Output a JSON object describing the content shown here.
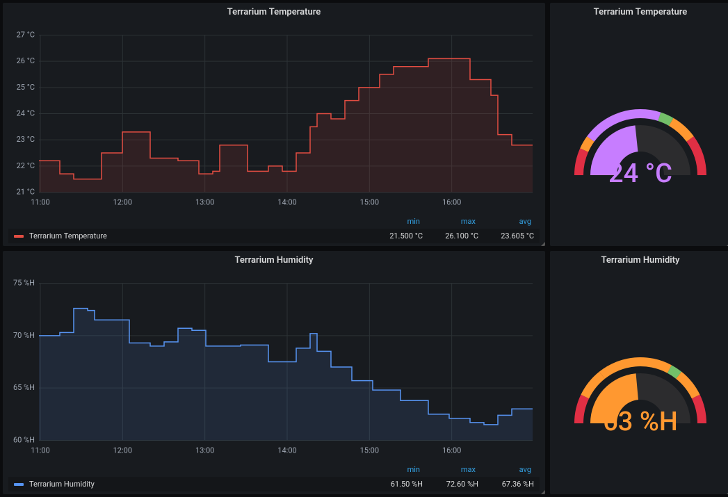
{
  "panels": {
    "temp_chart_title": "Terrarium Temperature",
    "temp_gauge_title": "Terrarium Temperature",
    "hum_chart_title": "Terrarium Humidity",
    "hum_gauge_title": "Terrarium Humidity"
  },
  "legend_headers": {
    "min": "min",
    "max": "max",
    "avg": "avg"
  },
  "temp_legend": {
    "name": "Terrarium Temperature",
    "color": "#e24d42",
    "min": "21.500 °C",
    "max": "26.100 °C",
    "avg": "23.605 °C"
  },
  "hum_legend": {
    "name": "Terrarium Humidity",
    "color": "#5794f2",
    "min": "61.50 %H",
    "max": "72.60 %H",
    "avg": "67.36 %H"
  },
  "temp_gauge": {
    "value_text": "24 °C",
    "value": 24,
    "min": 10,
    "max": 40,
    "color": "#c77dff",
    "thresholds": [
      {
        "from": 10,
        "to": 14,
        "color": "#e02f44"
      },
      {
        "from": 14,
        "to": 16,
        "color": "#ff9830"
      },
      {
        "from": 16,
        "to": 28,
        "color": "#c77dff"
      },
      {
        "from": 28,
        "to": 30,
        "color": "#73bf69"
      },
      {
        "from": 30,
        "to": 34,
        "color": "#ff9830"
      },
      {
        "from": 34,
        "to": 40,
        "color": "#e02f44"
      }
    ]
  },
  "hum_gauge": {
    "value_text": "63 %H",
    "value": 63,
    "min": 30,
    "max": 100,
    "color": "#ff9830",
    "thresholds": [
      {
        "from": 30,
        "to": 40,
        "color": "#e02f44"
      },
      {
        "from": 40,
        "to": 50,
        "color": "#ff9830"
      },
      {
        "from": 50,
        "to": 76,
        "color": "#ff9830"
      },
      {
        "from": 76,
        "to": 80,
        "color": "#73bf69"
      },
      {
        "from": 80,
        "to": 90,
        "color": "#ff9830"
      },
      {
        "from": 90,
        "to": 100,
        "color": "#e02f44"
      }
    ]
  },
  "chart_data": [
    {
      "type": "area",
      "title": "Terrarium Temperature",
      "xlabel": "",
      "ylabel": "°C",
      "ylim": [
        21,
        27
      ],
      "x_ticks": [
        "11:00",
        "12:00",
        "13:00",
        "14:00",
        "15:00",
        "16:00"
      ],
      "y_ticks": [
        21,
        22,
        23,
        24,
        25,
        26,
        27
      ],
      "series": [
        {
          "name": "Terrarium Temperature",
          "color": "#e24d42",
          "step": true,
          "y": [
            22.2,
            22.2,
            22.2,
            21.7,
            21.7,
            21.5,
            21.5,
            21.5,
            21.5,
            22.5,
            22.5,
            22.5,
            23.3,
            23.3,
            23.3,
            23.3,
            22.3,
            22.3,
            22.3,
            22.3,
            22.2,
            22.2,
            22.2,
            21.7,
            21.7,
            21.8,
            22.8,
            22.8,
            22.8,
            22.8,
            21.8,
            21.8,
            21.8,
            22.0,
            22.0,
            21.8,
            21.8,
            22.5,
            22.5,
            23.5,
            24.0,
            24.0,
            23.8,
            23.8,
            24.5,
            24.5,
            25.0,
            25.0,
            25.0,
            25.5,
            25.5,
            25.8,
            25.8,
            25.8,
            25.8,
            25.8,
            26.1,
            26.1,
            26.1,
            26.1,
            26.1,
            26.1,
            25.3,
            25.3,
            25.3,
            24.7,
            23.2,
            23.2,
            22.8,
            22.8,
            22.8,
            22.8
          ]
        }
      ]
    },
    {
      "type": "area",
      "title": "Terrarium Humidity",
      "xlabel": "",
      "ylabel": "%H",
      "ylim": [
        60,
        75
      ],
      "x_ticks": [
        "11:00",
        "12:00",
        "13:00",
        "14:00",
        "15:00",
        "16:00"
      ],
      "y_ticks": [
        60,
        65,
        70,
        75
      ],
      "series": [
        {
          "name": "Terrarium Humidity",
          "color": "#5794f2",
          "step": true,
          "y": [
            70.0,
            70.0,
            70.0,
            70.3,
            70.3,
            72.6,
            72.6,
            72.4,
            71.5,
            71.5,
            71.5,
            71.5,
            71.5,
            69.3,
            69.3,
            69.3,
            69.0,
            69.0,
            69.4,
            69.4,
            70.7,
            70.7,
            70.5,
            70.5,
            69.0,
            69.0,
            69.0,
            69.0,
            69.0,
            69.1,
            69.1,
            69.1,
            69.1,
            67.5,
            67.5,
            67.5,
            67.5,
            68.8,
            68.8,
            70.2,
            68.5,
            68.5,
            67.0,
            67.0,
            67.0,
            65.7,
            65.7,
            65.7,
            64.8,
            64.8,
            64.8,
            64.8,
            63.8,
            63.8,
            63.8,
            63.8,
            62.5,
            62.5,
            62.5,
            62.1,
            62.1,
            62.1,
            61.7,
            61.7,
            61.5,
            61.5,
            62.4,
            62.4,
            63.0,
            63.0,
            63.0,
            63.0
          ]
        }
      ]
    }
  ]
}
